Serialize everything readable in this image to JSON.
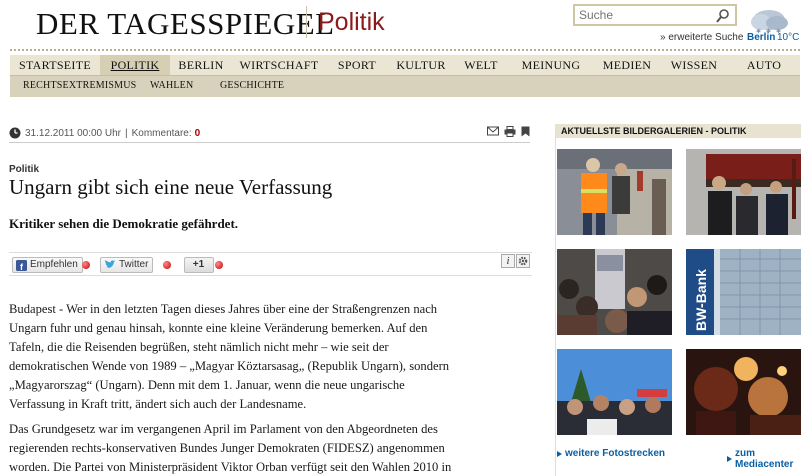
{
  "header": {
    "masthead": "DER TAGESSPIEGEL",
    "section": "Politik",
    "search_placeholder": "Suche",
    "advanced_search": "» erweiterte Suche",
    "weather_city": "Berlin",
    "weather_temp": "10°C"
  },
  "nav": {
    "items": [
      "STARTSEITE",
      "POLITIK",
      "BERLIN",
      "WIRTSCHAFT",
      "SPORT",
      "KULTUR",
      "WELT",
      "MEINUNG",
      "MEDIEN",
      "WISSEN",
      "AUTO"
    ],
    "active": "POLITIK"
  },
  "subnav": {
    "items": [
      "RECHTSEXTREMISMUS",
      "WAHLEN",
      "GESCHICHTE"
    ]
  },
  "article": {
    "date": "31.12.2011 00:00 Uhr",
    "separator": "|",
    "comments_label": "Kommentare:",
    "comments_count": "0",
    "kicker": "Politik",
    "headline": "Ungarn gibt sich eine neue Verfassung",
    "teaser": "Kritiker sehen die Demokratie gefährdet.",
    "share": {
      "facebook": "Empfehlen",
      "twitter": "Twitter",
      "plusone": "+1"
    },
    "paragraph1": [
      "Budapest - Wer in den letzten Tagen dieses Jahres über eine der Straßengrenzen nach",
      "Ungarn fuhr und genau hinsah, konnte eine kleine Veränderung bemerken. Auf den",
      "Tafeln, die die Reisenden begrüßen, steht nämlich nicht mehr – wie seit der",
      "demokratischen Wende von 1989 – „Magyar Köztarsasag„ (Republik Ungarn), sondern",
      "„Magyarorszag“ (Ungarn). Denn mit dem 1. Januar, wenn die neue ungarische",
      "Verfassung in Kraft tritt, ändert sich auch der Landesname."
    ],
    "paragraph2": [
      "Das Grundgesetz war im vergangenen April im Parlament von den Abgeordneten des",
      "regierenden rechts-konservativen Bundes Junger Demokraten (FIDESZ) angenommen",
      "worden. Die Partei von Ministerpräsident Viktor Orban verfügt seit den Wahlen 2010 in"
    ]
  },
  "sidebar": {
    "galleries_title": "AKTUELLSTE BILDERGALERIEN - POLITIK",
    "link_photos": "weitere Fotostrecken",
    "link_mediacenter": "zum Mediacenter"
  },
  "colors": {
    "section_red": "#8b1a1a",
    "nav_bg": "#ebe6d4",
    "subnav_bg": "#d8d2bd",
    "link_blue": "#0a5fa4"
  }
}
